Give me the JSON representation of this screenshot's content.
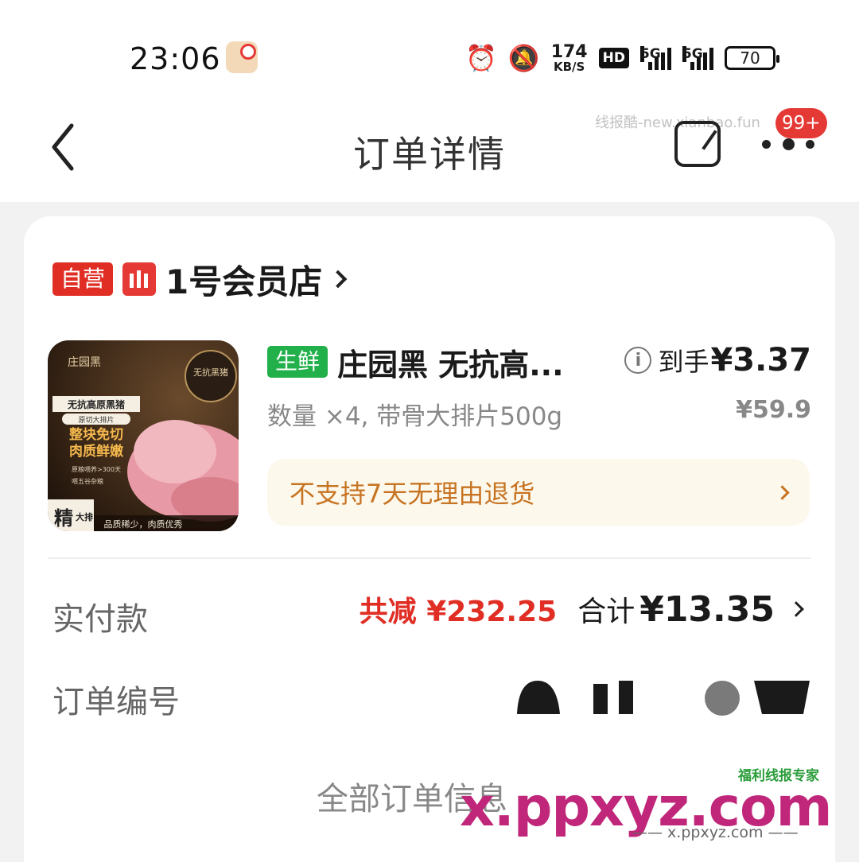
{
  "status_bar": {
    "time": "23:06",
    "net_speed_value": "174",
    "net_speed_unit": "KB/S",
    "hd_label": "HD",
    "sim1_label": "5G",
    "sim2_label": "5G",
    "battery": "70",
    "icons": [
      "app-notification-icon",
      "alarm-icon",
      "mute-icon",
      "hd-icon",
      "signal-icon",
      "battery-icon"
    ]
  },
  "header": {
    "title": "订单详情",
    "notification_badge": "99+",
    "watermark": "线报酷-new.xianbao.fun",
    "icons": [
      "back-icon",
      "share-icon",
      "more-icon"
    ]
  },
  "store": {
    "self_operated_tag": "自营",
    "name": "1号会员店"
  },
  "product": {
    "category_tag": "生鲜",
    "title": "庄园黑 无抗高...",
    "final_price_label": "到手",
    "final_price": "¥3.37",
    "spec": "数量 ×4, 带骨大排片500g",
    "original_price": "¥59.9",
    "return_notice": "不支持7天无理由退货",
    "image": {
      "brand": "庄园黑",
      "badge": "无抗黑猪",
      "line1": "无抗高原黑猪",
      "line2": "原切大排片",
      "line3": "整块免切",
      "line4": "肉质鲜嫩",
      "line5": "原粮喂养>300天",
      "line6": "喂五谷杂粮",
      "corner_big": "精",
      "corner_small": "大排",
      "footer": "品质稀少，肉质优秀"
    }
  },
  "payment": {
    "label": "实付款",
    "saved": "共减 ¥232.25",
    "total_label": "合计",
    "total": "¥13.35"
  },
  "order_number": {
    "label": "订单编号"
  },
  "footer_link": "全部订单信息",
  "watermark_bottom": {
    "tagline": "福利线报专家",
    "main": "x.ppxyz.com",
    "url": "—— x.ppxyz.com ——"
  },
  "colors": {
    "accent_red": "#e02e24",
    "fresh_green": "#22b04b",
    "notice_orange": "#c77422"
  }
}
